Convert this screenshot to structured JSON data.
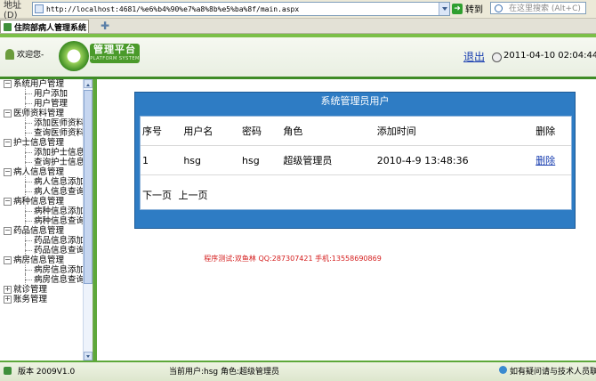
{
  "browser": {
    "address_label": "地址(D)",
    "url": "http://localhost:4681/%e6%b4%90%e7%a8%8b%e5%ba%8f/main.aspx",
    "go_label": "转到",
    "search_placeholder": "在这里搜索 (Alt+C)",
    "tab_title": "住院部病人管理系统"
  },
  "header": {
    "welcome": "欢迎您-",
    "logo_title": "管理平台",
    "logo_subtitle": "PLATFORM SYSTEM",
    "logout": "退出",
    "datetime": "2011-04-10 02:04:44 PM"
  },
  "sidebar": {
    "groups": [
      {
        "label": "系统用户管理",
        "items": [
          "用户添加",
          "用户管理"
        ]
      },
      {
        "label": "医师资料管理",
        "items": [
          "添加医师资料",
          "查询医师资料"
        ]
      },
      {
        "label": "护士信息管理",
        "items": [
          "添加护士信息",
          "查询护士信息"
        ]
      },
      {
        "label": "病人信息管理",
        "items": [
          "病人信息添加",
          "病人信息查询"
        ]
      },
      {
        "label": "病种信息管理",
        "items": [
          "病种信息添加",
          "病种信息查询"
        ]
      },
      {
        "label": "药品信息管理",
        "items": [
          "药品信息添加",
          "药品信息查询"
        ]
      },
      {
        "label": "病房信息管理",
        "items": [
          "病房信息添加",
          "病房信息查询"
        ]
      },
      {
        "label": "就诊管理",
        "items": []
      },
      {
        "label": "账务管理",
        "items": []
      }
    ]
  },
  "main": {
    "panel_title": "系统管理员用户",
    "columns": [
      "序号",
      "用户名",
      "密码",
      "角色",
      "添加时间",
      "删除"
    ],
    "rows": [
      {
        "id": "1",
        "username": "hsg",
        "password": "hsg",
        "role": "超级管理员",
        "added": "2010-4-9 13:48:36",
        "action": "删除"
      }
    ],
    "pager": {
      "next": "下一页",
      "prev": "上一页"
    },
    "credits": "程序测试:双鱼林 QQ:287307421 手机:13558690869"
  },
  "statusbar": {
    "version": "版本 2009V1.0",
    "current_user": "当前用户:hsg 角色:超级管理员",
    "help": "如有疑问请与技术人员联系"
  },
  "colors": {
    "accent_green": "#5da83a",
    "panel_blue": "#2e7cc4",
    "credit_red": "#d41c1c"
  }
}
